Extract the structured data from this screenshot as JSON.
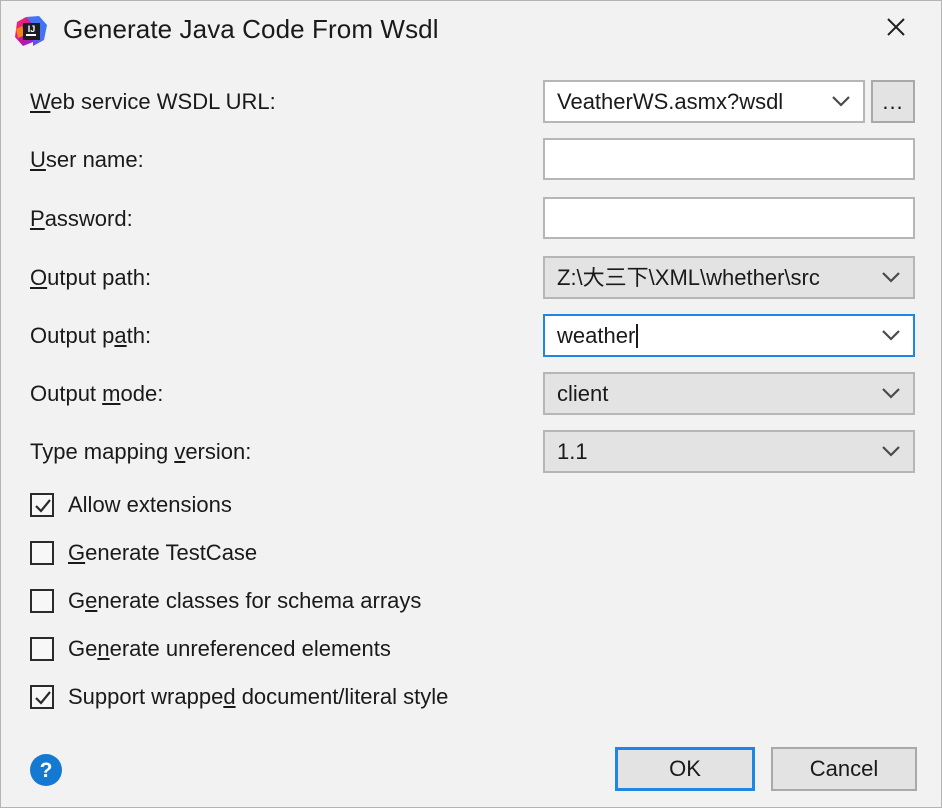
{
  "dialog": {
    "title": "Generate Java Code From Wsdl",
    "icon": "intellij-idea-logo",
    "close_label": "Close"
  },
  "fields": {
    "wsdl_url": {
      "label_pre": "",
      "label_mnemonic": "W",
      "label_post": "eb service WSDL URL:",
      "value": "WeatherWS.asmx?wsdl",
      "display_value": "VeatherWS.asmx?wsdl",
      "browse_label": "..."
    },
    "user_name": {
      "label_pre": "",
      "label_mnemonic": "U",
      "label_post": "ser name:",
      "value": "",
      "placeholder": ""
    },
    "password": {
      "label_pre": "",
      "label_mnemonic": "P",
      "label_post": "assword:",
      "value": "",
      "placeholder": ""
    },
    "output_path": {
      "label_pre": "",
      "label_mnemonic": "O",
      "label_post": "utput path:",
      "value": "Z:\\大三下\\XML\\whether\\src"
    },
    "output_package": {
      "label_pre": "Output p",
      "label_mnemonic": "a",
      "label_post": "th:",
      "value": "weather"
    },
    "output_mode": {
      "label_pre": "Output ",
      "label_mnemonic": "m",
      "label_post": "ode:",
      "value": "client"
    },
    "type_mapping_version": {
      "label_pre": "Type mapping ",
      "label_mnemonic": "v",
      "label_post": "ersion:",
      "value": "1.1"
    }
  },
  "checkboxes": [
    {
      "pre": "Allow extensions",
      "mnemonic": "",
      "post": "",
      "checked": true
    },
    {
      "pre": "",
      "mnemonic": "G",
      "post": "enerate TestCase",
      "checked": false
    },
    {
      "pre": "G",
      "mnemonic": "e",
      "post": "nerate classes for schema arrays",
      "checked": false
    },
    {
      "pre": "Ge",
      "mnemonic": "n",
      "post": "erate unreferenced elements",
      "checked": false
    },
    {
      "pre": "Support wrappe",
      "mnemonic": "d",
      "post": " document/literal style",
      "checked": true
    }
  ],
  "footer": {
    "help_label": "?",
    "ok_label": "OK",
    "cancel_label": "Cancel"
  },
  "colors": {
    "dialog_background": "#f2f2f2",
    "focus_blue": "#1e87e5",
    "help_blue": "#1479d1",
    "field_border": "#b6b6b6",
    "disabled_field": "#e3e3e3",
    "text": "#1a1a1a"
  }
}
